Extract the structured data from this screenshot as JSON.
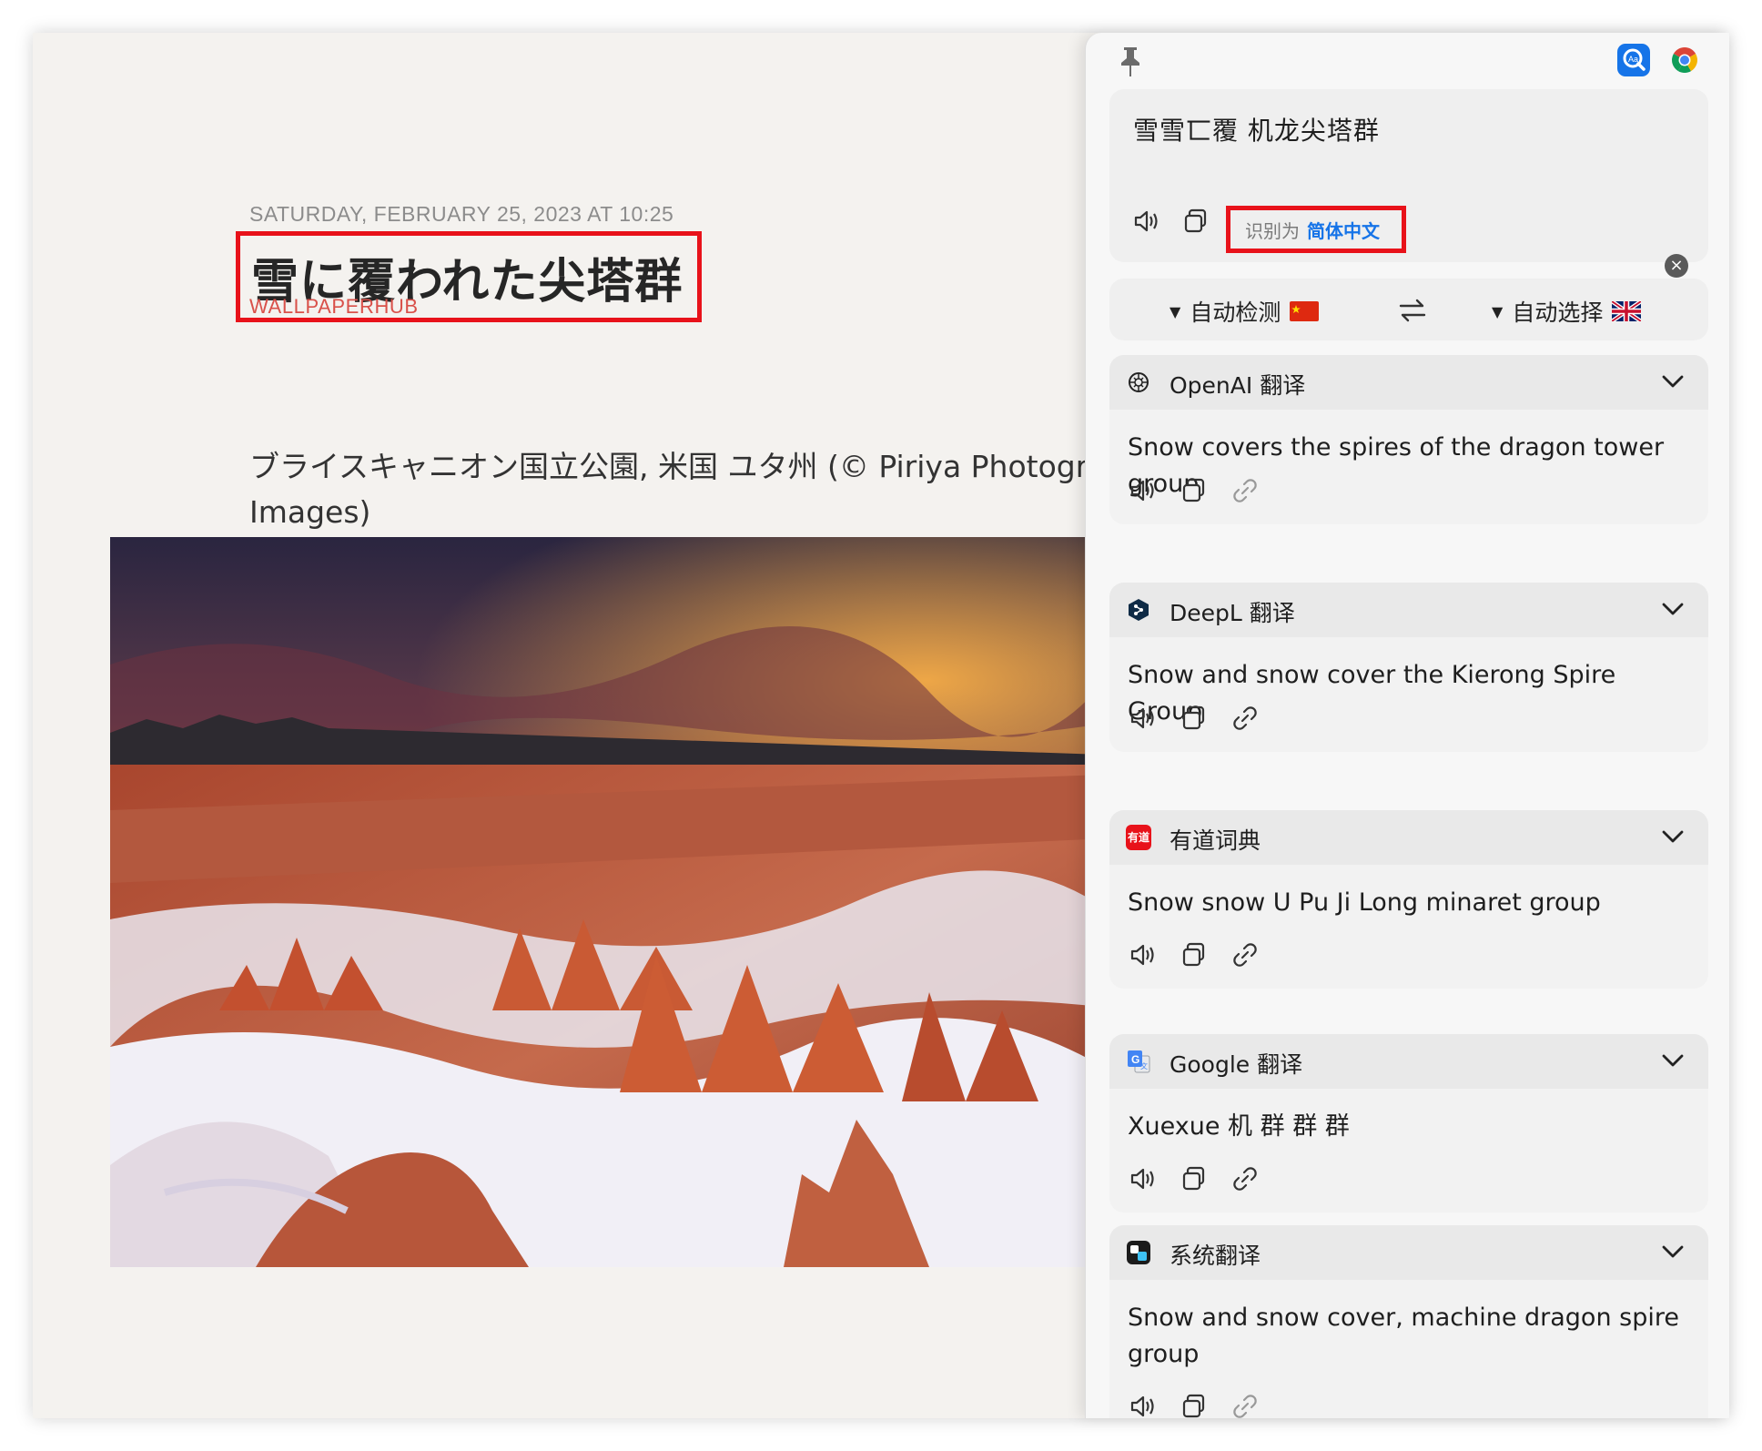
{
  "article": {
    "date": "SATURDAY, FEBRUARY 25, 2023 AT 10:25",
    "title": "雪に覆われた尖塔群",
    "source": "WALLPAPERHUB",
    "caption_line1": "ブライスキャニオン国立公園, 米国 ユタ州 (© Piriya Photograp",
    "caption_line2": "Images)"
  },
  "panel": {
    "input_text": "雪雪匸覆 机龙尖塔群",
    "detected_label": "识别为",
    "detected_language": "简体中文",
    "source_language": "自动检测",
    "target_language": "自动选择",
    "services": [
      {
        "name": "OpenAI 翻译",
        "logo": "openai-logo",
        "result": "Snow covers the spires of the dragon tower group"
      },
      {
        "name": "DeepL 翻译",
        "logo": "deepl-logo",
        "result": "Snow and snow cover the Kierong Spire Group"
      },
      {
        "name": "有道词典",
        "logo": "youdao-logo",
        "logo_text": "有道",
        "result": "Snow snow U Pu Ji Long minaret group"
      },
      {
        "name": "Google 翻译",
        "logo": "google-translate-logo",
        "result": "Xuexue 机 群 群 群"
      },
      {
        "name": "系统翻译",
        "logo": "system-translate-logo",
        "result": "Snow and snow cover, machine dragon spire group"
      }
    ]
  },
  "colors": {
    "highlight_box": "#e8121a",
    "source_text": "#d9514a",
    "link_blue": "#1674e8",
    "panel_bg": "#f7f7f7"
  }
}
